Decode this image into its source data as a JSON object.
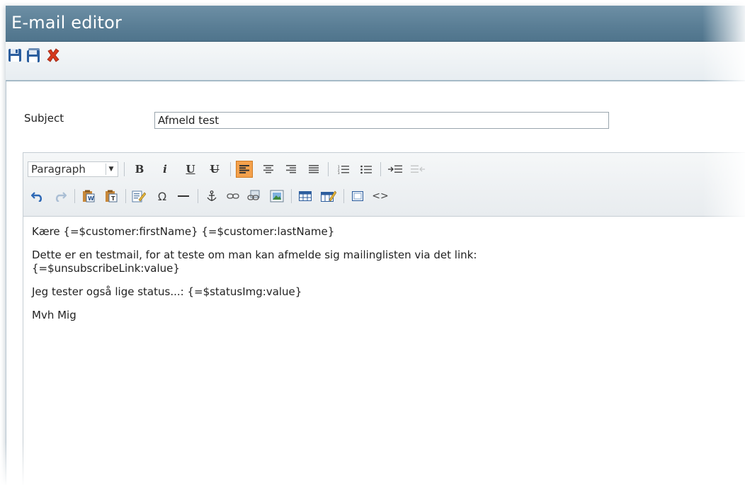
{
  "window": {
    "title": "E-mail editor"
  },
  "toolbar": {
    "buttons": [
      {
        "name": "save",
        "icon": "floppy-disk-icon"
      },
      {
        "name": "save-and-close",
        "icon": "floppy-disk-close-icon"
      },
      {
        "name": "close",
        "icon": "red-x-icon"
      }
    ]
  },
  "form": {
    "subject_label": "Subject",
    "subject_value": "Afmeld test"
  },
  "editor": {
    "format_select": "Paragraph",
    "toolbar_row1": {
      "bold": "B",
      "italic": "i",
      "underline": "U",
      "strikethrough": "U",
      "align_left_active": true
    },
    "content": [
      "Kære {=$customer:firstName} {=$customer:lastName}",
      "Dette er en testmail, for at teste om man kan afmelde sig mailinglisten via det link:",
      "{=$unsubscribeLink:value}",
      "Jeg tester også lige status...: {=$statusImg:value}",
      "Mvh Mig"
    ]
  },
  "colors": {
    "titlebar": "#5b7f96",
    "active_button": "#f4a14c",
    "close_icon": "#d63a1e",
    "save_icon": "#2b5e9e"
  }
}
